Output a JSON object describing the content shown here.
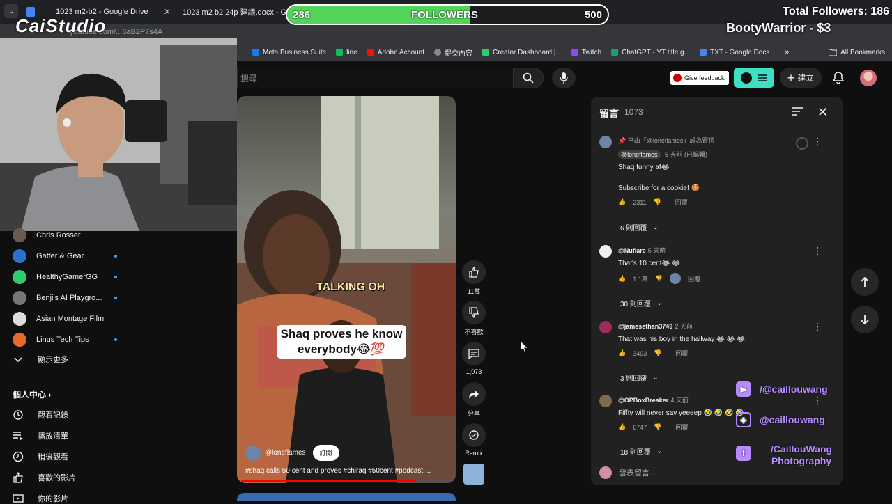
{
  "browser": {
    "tabs": [
      {
        "label": "1023 m2-b2 - Google Drive",
        "icon": "drive-icon"
      },
      {
        "label": "1023 m2 b2 24p 建議.docx - G",
        "icon": "docs-icon"
      }
    ],
    "url": "youtube.com/...6aB2P7s4A",
    "bookmarks": [
      "Meta Business Suite",
      "line",
      "Adobe Account",
      "提交內容",
      "Creator Dashboard |...",
      "Twitch",
      "ChatGPT - YT title g...",
      "TXT - Google Docs"
    ],
    "all_bookmarks": "All Bookmarks"
  },
  "overlay": {
    "logo": "CaiStudio",
    "followers_current": "286",
    "followers_label": "FOLLOWERS",
    "followers_goal": "500",
    "followers_progress": 0.572,
    "total_followers": "Total Followers: 186",
    "donation": "BootyWarrior - $3",
    "social": [
      {
        "icon": "youtube-icon",
        "handle": "/@caillouwang",
        "color": "#c8b4ff"
      },
      {
        "icon": "instagram-icon",
        "handle": "@caillouwang",
        "color": "#c8b4ff"
      },
      {
        "icon": "facebook-icon",
        "handle": "/CaillouWang Photography",
        "color": "#c8b4ff"
      }
    ]
  },
  "youtube": {
    "search_placeholder": "搜尋",
    "feedback": "Give feedback",
    "create": "建立"
  },
  "sidebar": {
    "subscriptions": [
      {
        "name": "Chris Rosser",
        "color": "#6b5b4d"
      },
      {
        "name": "Gaffer & Gear",
        "color": "#2f6fd1"
      },
      {
        "name": "HealthyGamerGG",
        "color": "#2ecc71"
      },
      {
        "name": "Benji's AI Playgro...",
        "color": "#777"
      },
      {
        "name": "Asian Montage Film",
        "color": "#ddd"
      },
      {
        "name": "Linus Tech Tips",
        "color": "#e8682b"
      }
    ],
    "show_more": "顯示更多",
    "you_title": "個人中心",
    "you_items": [
      {
        "label": "觀看記錄",
        "icon": "history-icon"
      },
      {
        "label": "播放清單",
        "icon": "playlist-icon"
      },
      {
        "label": "稍後觀看",
        "icon": "watch-later-icon"
      },
      {
        "label": "喜歡的影片",
        "icon": "like-icon"
      },
      {
        "label": "你的影片",
        "icon": "your-videos-icon"
      }
    ]
  },
  "short": {
    "caption_top": "TALKING OH",
    "caption_main": "Shaq proves he know everybody😂💯",
    "channel": "@loneflames",
    "subscribe": "訂閱",
    "title": "#shaq calls 50 cent and proves #chiraq #50cent #podcast ...",
    "progress": 0.83,
    "actions": [
      {
        "icon": "thumbs-up-icon",
        "label": "11萬"
      },
      {
        "icon": "thumbs-down-icon",
        "label": "不喜歡"
      },
      {
        "icon": "comment-icon",
        "label": "1,073"
      },
      {
        "icon": "share-icon",
        "label": "分享"
      },
      {
        "icon": "remix-icon",
        "label": "Remix"
      }
    ]
  },
  "comments": {
    "title": "留言",
    "count": "1073",
    "input_placeholder": "發表留言...",
    "items": [
      {
        "pinned": "已由「@loneflames」設為置頂",
        "author": "@loneflames",
        "time": "5 天前 (已編輯)",
        "text": "Shaq funny af😂",
        "text2": "Subscribe for a cookie! 🍪",
        "likes": "2311",
        "reply": "回覆",
        "replies": "6 則回覆",
        "avatar_color": "#6d86a8"
      },
      {
        "author": "@Nuflare",
        "time": "5 天前",
        "text": "That's 10 cent😂 😂",
        "likes": "1.1萬",
        "reply": "回覆",
        "replies": "30 則回覆",
        "avatar_color": "#eeeeee"
      },
      {
        "author": "@jamesethan3749",
        "time": "2 天前",
        "text": "That was his boy in the hallway 😂 😂 😂",
        "likes": "3493",
        "reply": "回覆",
        "replies": "3 則回覆",
        "avatar_color": "#9c2c5c"
      },
      {
        "author": "@OPBoxBreaker",
        "time": "4 天前",
        "text": "Fiffty will never say yeeeep 🤣 🤣 🤣 🤣",
        "likes": "6747",
        "reply": "回覆",
        "replies": "18 則回覆",
        "avatar_color": "#7d6a50"
      }
    ]
  }
}
